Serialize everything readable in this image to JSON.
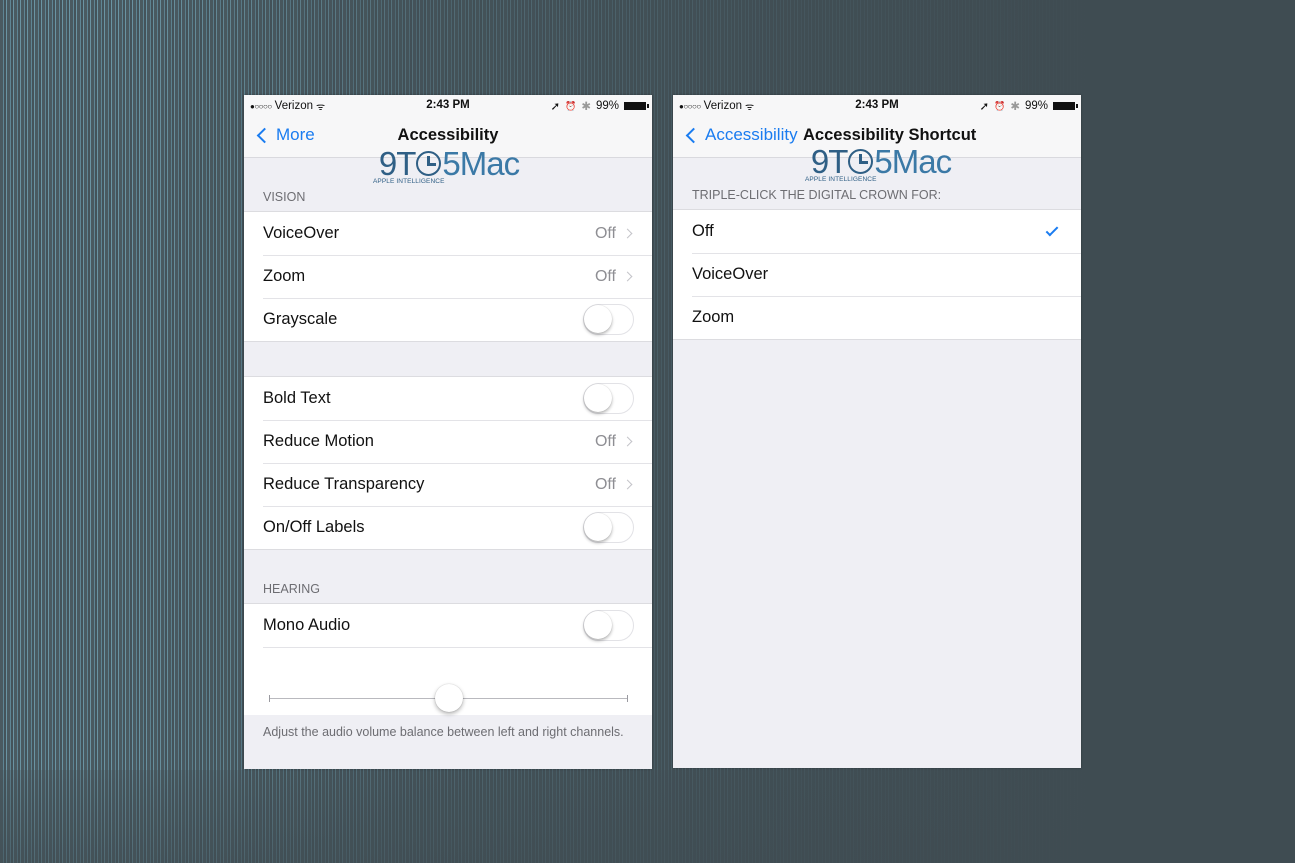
{
  "status_bar": {
    "signal_dots": "●○○○○",
    "carrier": "Verizon",
    "wifi_icon": "wifi-icon",
    "time": "2:43 PM",
    "location_icon": "➚",
    "alarm_icon": "⏰",
    "bluetooth_icon": "✱",
    "battery_percent": "99%"
  },
  "watermark": {
    "logo_prefix": "9T",
    "logo_suffix": "5Mac",
    "subtitle": "APPLE INTELLIGENCE"
  },
  "left_screen": {
    "back_label": "More",
    "title": "Accessibility",
    "vision_header": "VISION",
    "vision_rows": [
      {
        "label": "VoiceOver",
        "value": "Off",
        "type": "disclosure"
      },
      {
        "label": "Zoom",
        "value": "Off",
        "type": "disclosure"
      },
      {
        "label": "Grayscale",
        "type": "toggle",
        "on": false
      }
    ],
    "display_rows": [
      {
        "label": "Bold Text",
        "type": "toggle",
        "on": false
      },
      {
        "label": "Reduce Motion",
        "value": "Off",
        "type": "disclosure"
      },
      {
        "label": "Reduce Transparency",
        "value": "Off",
        "type": "disclosure"
      },
      {
        "label": "On/Off Labels",
        "type": "toggle",
        "on": false
      }
    ],
    "hearing_header": "HEARING",
    "hearing_rows": [
      {
        "label": "Mono Audio",
        "type": "toggle",
        "on": false
      }
    ],
    "balance_slider": {
      "value": 0.5
    },
    "balance_footer": "Adjust the audio volume balance between left and right channels."
  },
  "right_screen": {
    "back_label": "Accessibility",
    "title": "Accessibility Shortcut",
    "section_header": "TRIPLE-CLICK THE DIGITAL CROWN FOR:",
    "options": [
      {
        "label": "Off",
        "selected": true
      },
      {
        "label": "VoiceOver",
        "selected": false
      },
      {
        "label": "Zoom",
        "selected": false
      }
    ]
  },
  "colors": {
    "accent": "#1a7cf0",
    "background": "#3f4c52",
    "grouped_bg": "#efeff4",
    "secondary_text": "#8e8e93"
  }
}
